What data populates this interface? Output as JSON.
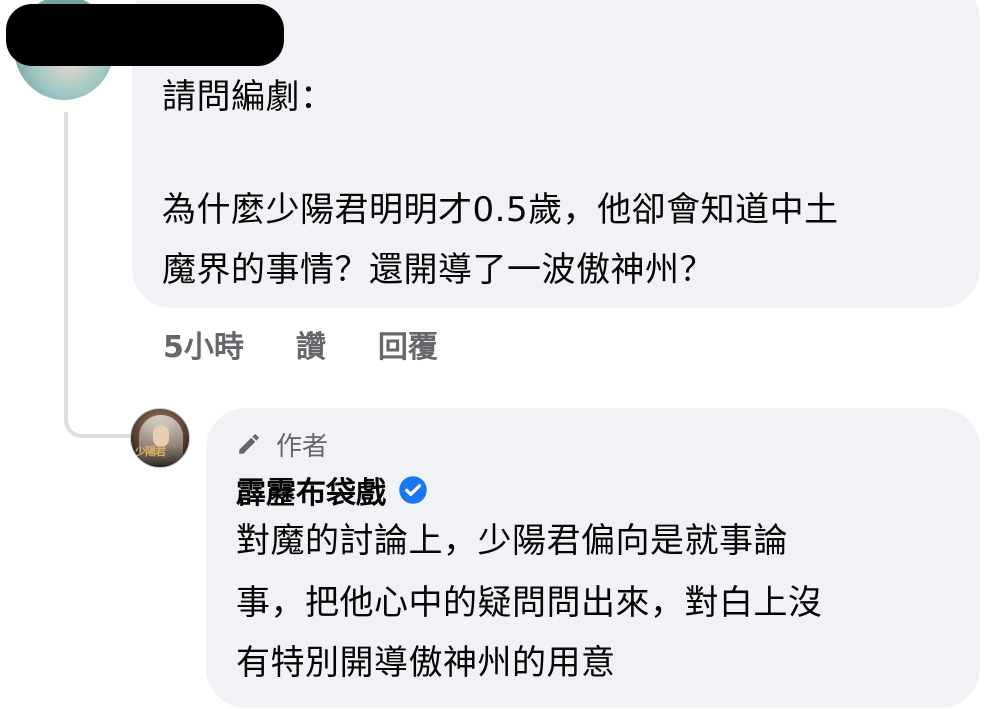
{
  "top_comment": {
    "lines": [
      "請問編劇：",
      "為什麼少陽君明明才0.5歲，他卻會知道中土",
      "魔界的事情？還開導了一波傲神州？"
    ],
    "actions": {
      "time": "5小時",
      "like": "讚",
      "reply": "回覆"
    }
  },
  "reply": {
    "badge_label": "作者",
    "badge_icon": "pencil-icon",
    "author_name": "霹靂布袋戲",
    "verified_icon": "verified-badge-icon",
    "verified_color": "#1877f2",
    "avatar_text": "少陽君",
    "lines": [
      "對魔的討論上，少陽君偏向是就事論",
      "事，把他心中的疑問問出來，對白上沒",
      "有特別開導傲神州的用意"
    ]
  }
}
